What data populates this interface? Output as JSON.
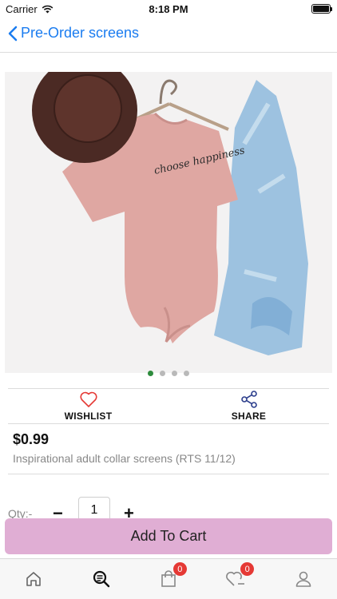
{
  "status_bar": {
    "carrier": "Carrier",
    "time": "8:18 PM"
  },
  "nav": {
    "back_label": "Pre-Order screens"
  },
  "carousel": {
    "page_count": 4,
    "active_index": 0
  },
  "actions": {
    "wishlist_label": "WISHLIST",
    "share_label": "SHARE"
  },
  "product": {
    "price": "$0.99",
    "description": "Inspirational adult collar screens (RTS 11/12)",
    "shirt_text": "choose happiness"
  },
  "quantity": {
    "label": "Qty:-",
    "minus": "−",
    "value": "1",
    "plus": "+"
  },
  "cart": {
    "button_label": "Add To Cart"
  },
  "tabbar": {
    "tabs": [
      {
        "icon": "home-icon",
        "active": false
      },
      {
        "icon": "search-icon",
        "active": true
      },
      {
        "icon": "shopping-bag-icon",
        "badge": "0"
      },
      {
        "icon": "heart-icon",
        "badge": "0"
      },
      {
        "icon": "user-icon",
        "active": false
      }
    ]
  },
  "colors": {
    "accent": "#1a7cf0",
    "cart_button": "#e0aed4",
    "badge": "#e53935",
    "active_dot": "#2e8b3d"
  }
}
